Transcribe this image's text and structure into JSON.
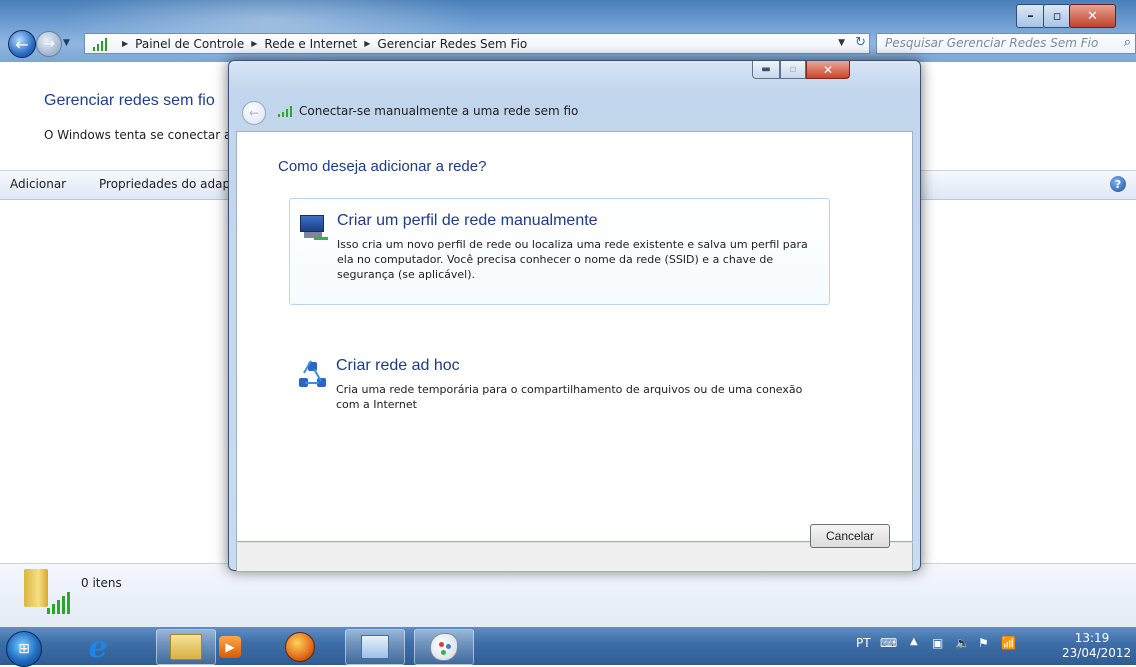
{
  "explorer": {
    "breadcrumb": [
      "Painel de Controle",
      "Rede e Internet",
      "Gerenciar Redes Sem Fio"
    ],
    "search_placeholder": "Pesquisar Gerenciar Redes Sem Fio",
    "page_title": "Gerenciar redes sem fio",
    "page_desc": "O Windows tenta se conectar a",
    "commands": [
      "Adicionar",
      "Propriedades do adap"
    ],
    "items_count": "0 itens"
  },
  "dialog": {
    "title": "Conectar-se manualmente a uma rede sem fio",
    "question": "Como deseja adicionar a rede?",
    "options": [
      {
        "title": "Criar um perfil de rede manualmente",
        "description": "Isso cria um novo perfil de rede ou localiza uma rede existente e salva um perfil para ela no computador. Você precisa conhecer o nome da rede (SSID) e a chave de segurança (se aplicável).",
        "icon": "network-pc-icon"
      },
      {
        "title": "Criar rede ad hoc",
        "description": "Cria uma rede temporária para o compartilhamento de arquivos ou de uma conexão com a Internet",
        "icon": "adhoc-network-icon"
      }
    ],
    "cancel_label": "Cancelar"
  },
  "taskbar": {
    "language": "PT",
    "time": "13:19",
    "date": "23/04/2012"
  },
  "colors": {
    "accent_text": "#1e3a8a",
    "taskbar": "#3f6fa8"
  }
}
